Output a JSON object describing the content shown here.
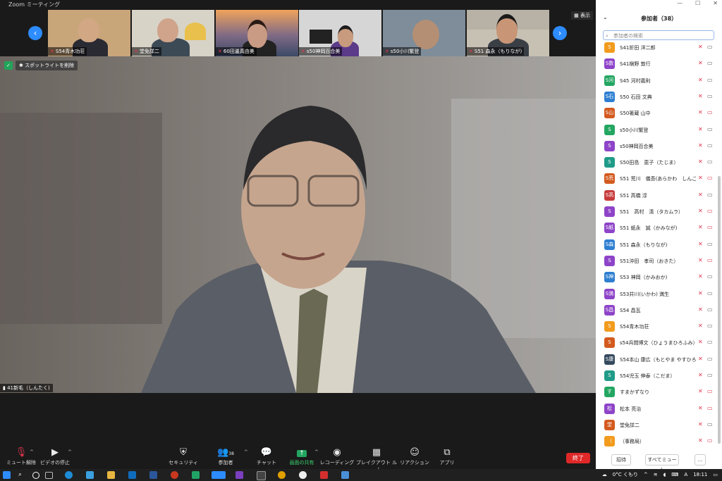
{
  "window": {
    "title": "Zoom ミーティング"
  },
  "strip": {
    "show_label": "表示",
    "tiles": [
      {
        "name": "S54青木功荘"
      },
      {
        "name": "堂免詳二"
      },
      {
        "name": "60田邊真由美"
      },
      {
        "name": "s50神岡百合美"
      },
      {
        "name": "s50小川繁登"
      },
      {
        "name": "S51 森永（もりなが)"
      }
    ]
  },
  "main": {
    "spotlight_label": "スポットライトを削除",
    "speaker_name": "41新毛（しんたく)"
  },
  "toolbar": {
    "mute": "ミュート解除",
    "video": "ビデオの停止",
    "security": "セキュリティ",
    "participants": "参加者",
    "participants_count": "38",
    "chat": "チャット",
    "share": "画面の共有",
    "record": "レコーディング",
    "breakout": "ブレイクアウト ルーム",
    "reactions": "リアクション",
    "apps": "アプリ",
    "end": "終了"
  },
  "panel": {
    "title": "参加者（38）",
    "search_placeholder": "参加者の検索",
    "invite": "招待",
    "mute_all": "すべてミュート",
    "more": "...",
    "participants": [
      {
        "avatar": "S",
        "color": "#f29b1d",
        "name": "S41折田 洋二郎",
        "video_off": false
      },
      {
        "avatar": "S数",
        "color": "#8e44c8",
        "name": "S41槇野 敦行",
        "video_off": false
      },
      {
        "avatar": "S河",
        "color": "#23a661",
        "name": "S45 河村義則",
        "video_off": false
      },
      {
        "avatar": "S石",
        "color": "#2e7fd1",
        "name": "S50 石田 文典",
        "video_off": false
      },
      {
        "avatar": "S山",
        "color": "#d35a1e",
        "name": "S50箸蔵 山中",
        "video_off": true
      },
      {
        "avatar": "S",
        "color": "#23a661",
        "name": "s50小川繁登",
        "video_off": false
      },
      {
        "avatar": "S",
        "color": "#8e44c8",
        "name": "s50神岡百合美",
        "video_off": false
      },
      {
        "avatar": "S",
        "color": "#1f9b88",
        "name": "S50田島　恵子（たじま）",
        "video_off": false
      },
      {
        "avatar": "S荒",
        "color": "#d35a1e",
        "name": "S51 荒川　儀吾(あらかわ　しんご)",
        "video_off": true
      },
      {
        "avatar": "S高",
        "color": "#c73b3b",
        "name": "S51 高橋 淳",
        "video_off": false
      },
      {
        "avatar": "S",
        "color": "#8e44c8",
        "name": "S51　高村　清（タカムラ）",
        "video_off": true
      },
      {
        "avatar": "S紙",
        "color": "#8e44c8",
        "name": "S51 紙永　誠（かみなが)",
        "video_off": true
      },
      {
        "avatar": "S森",
        "color": "#2e7fd1",
        "name": "S51 森永（もりなが)",
        "video_off": false
      },
      {
        "avatar": "S",
        "color": "#8e44c8",
        "name": "S51沖田　孝司（おきた）",
        "video_off": true
      },
      {
        "avatar": "S神",
        "color": "#2e7fd1",
        "name": "S53 神岡（かみおか)",
        "video_off": false
      },
      {
        "avatar": "S満",
        "color": "#8e44c8",
        "name": "S53井川(いかわ) 満生",
        "video_off": false
      },
      {
        "avatar": "S昌",
        "color": "#8e44c8",
        "name": "S54 昌瓦",
        "video_off": false
      },
      {
        "avatar": "S",
        "color": "#f29b1d",
        "name": "S54青木功荘",
        "video_off": false
      },
      {
        "avatar": "S",
        "color": "#d35a1e",
        "name": "s54兵間博文（ひょうまひろふみ）",
        "video_off": false
      },
      {
        "avatar": "S康",
        "color": "#34495e",
        "name": "S54本山 康広（もとやま やすひろ）",
        "video_off": false
      },
      {
        "avatar": "S",
        "color": "#1f9b88",
        "name": "S54児玉 伸泰（こだま）",
        "video_off": false
      },
      {
        "avatar": "す",
        "color": "#23a661",
        "name": "すまかずなり",
        "video_off": true
      },
      {
        "avatar": "松",
        "color": "#8e44c8",
        "name": "松本 亮治",
        "video_off": true
      },
      {
        "avatar": "堂",
        "color": "#d35a1e",
        "name": "堂免詳二",
        "video_off": false
      },
      {
        "avatar": "（",
        "color": "#f29b1d",
        "name": "（事務局）",
        "video_off": true
      }
    ]
  },
  "taskbar": {
    "weather": "0°C くもり",
    "ime": "A",
    "time": "18:11"
  }
}
